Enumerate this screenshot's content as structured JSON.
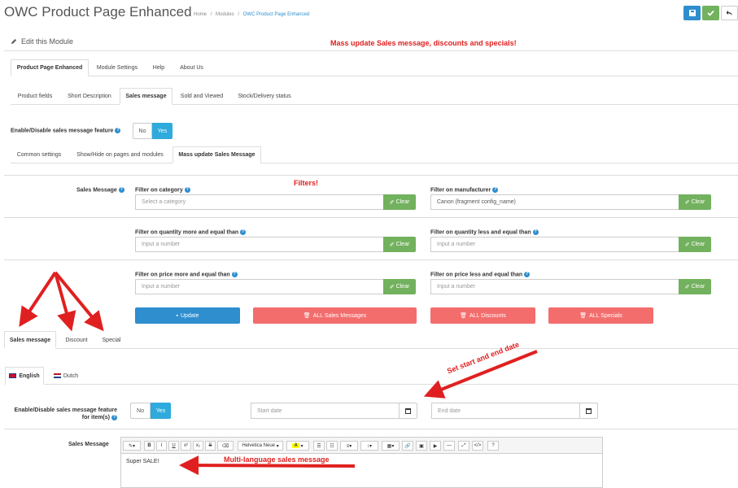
{
  "header": {
    "title": "OWC Product Page Enhanced",
    "breadcrumb": [
      "Home",
      "Modules",
      "OWC Product Page Enhanced"
    ],
    "breadcrumb_sep": "/"
  },
  "panel": {
    "heading": "Edit this Module",
    "banner": "Mass update Sales message, discounts and specials!"
  },
  "main_tabs": [
    "Product Page Enhanced",
    "Module Settings",
    "Help",
    "About Us"
  ],
  "sub_tabs": [
    "Product fields",
    "Short Description",
    "Sales message",
    "Sold and Viewed",
    "Stock/Delivery status"
  ],
  "feature": {
    "label": "Enable/Disable sales message feature",
    "no": "No",
    "yes": "Yes"
  },
  "inner_tabs": [
    "Common settings",
    "Show/Hide on pages and modules",
    "Mass update Sales Message"
  ],
  "filters": {
    "annotation": "Filters!",
    "sales_message_label": "Sales Message",
    "category_label": "Filter on category",
    "category_placeholder": "Select a category",
    "manufacturer_label": "Filter on manufacturer",
    "manufacturer_value": "Canon (fragment config_name)",
    "qty_more_label": "Filter on quantity more and equal than",
    "qty_less_label": "Filter on quantity less and equal than",
    "price_more_label": "Filter on price more and equal than",
    "price_less_label": "Filter on price less and equal than",
    "number_placeholder": "Input a number",
    "clear": "Clear"
  },
  "actions": {
    "update": "Update",
    "all_sales": "ALL Sales Messages",
    "all_discounts": "ALL Discounts",
    "all_specials": "ALL Specials"
  },
  "bottom_tabs": [
    "Sales message",
    "Discount",
    "Special"
  ],
  "lang_tabs": [
    "English",
    "Dutch"
  ],
  "item_feature": {
    "label_line1": "Enable/Disable sales message feature",
    "label_line2": "for item(s)",
    "no": "No",
    "yes": "Yes",
    "start_placeholder": "Start date",
    "end_placeholder": "End date"
  },
  "annotations": {
    "dates": "Set start and end date",
    "multilang": "Multi-language sales message"
  },
  "editor": {
    "label": "Sales Message",
    "font": "Helvetica Neue",
    "content": "Super SALE!"
  },
  "colors": {
    "primary": "#2e8ece",
    "success": "#72b15e",
    "danger": "#f36d6d",
    "annotation": "#e02020"
  }
}
